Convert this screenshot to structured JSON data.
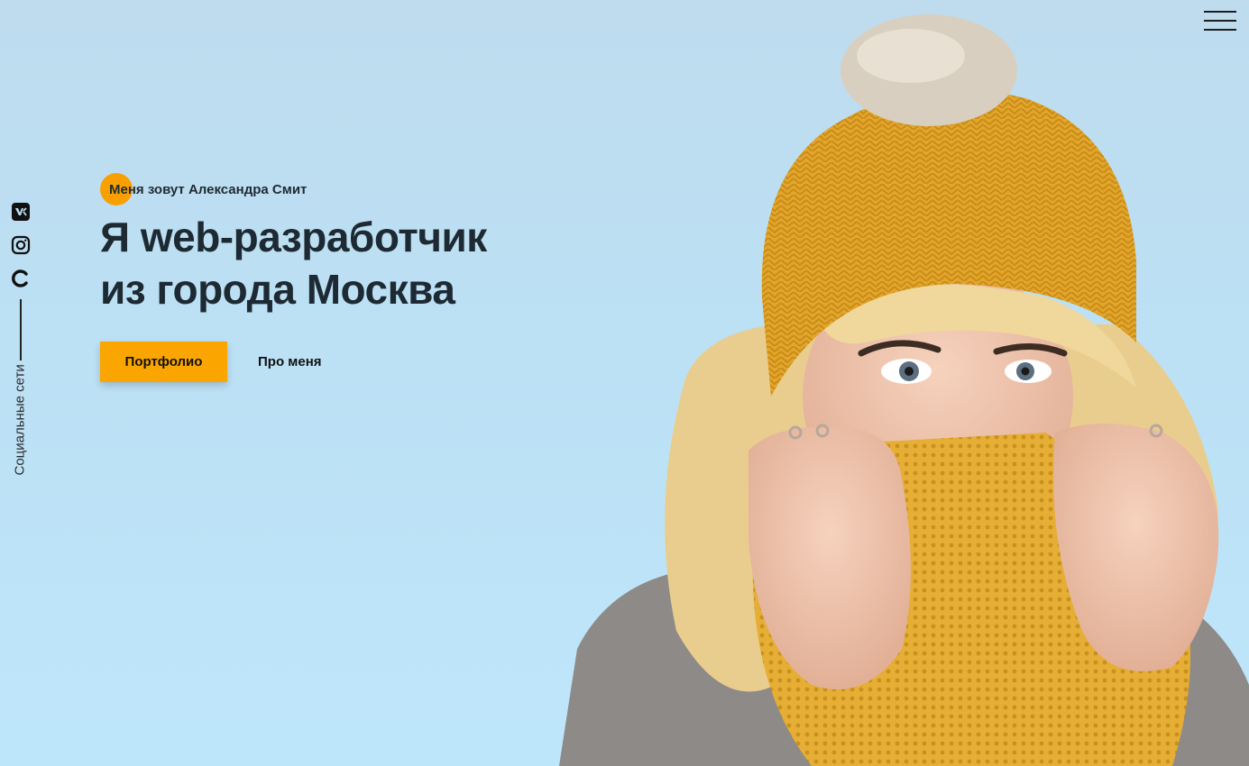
{
  "nav": {
    "menu_icon": "burger-menu-icon"
  },
  "social": {
    "label": "Социальные сети",
    "icons": [
      "vk-icon",
      "instagram-icon",
      "copyright-icon"
    ]
  },
  "hero": {
    "intro": "Меня зовут Александра Смит",
    "title_line1": "Я web-разработчик",
    "title_line2": "из города Москва",
    "primary_button": "Портфолио",
    "secondary_link": "Про меня"
  },
  "colors": {
    "accent": "#faa500",
    "background": "#bce0f4",
    "text": "#1e2a33"
  },
  "photo": {
    "subject": "woman in yellow knit hat and scarf"
  }
}
